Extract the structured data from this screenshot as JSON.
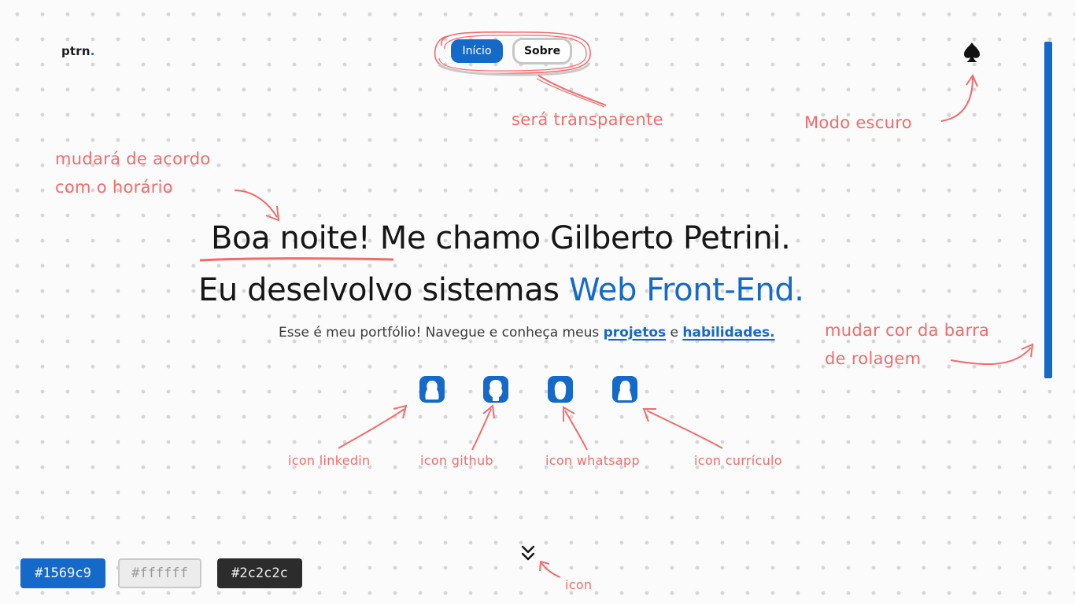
{
  "header": {
    "logo_text": "ptrn",
    "logo_dot": ".",
    "nav": {
      "home_label": "Início",
      "about_label": "Sobre"
    },
    "theme_toggle_icon": "spade-icon"
  },
  "annotations": {
    "nav_note": "será transparente",
    "theme_note": "Modo escuro",
    "greeting_note_line1": "mudará de acordo",
    "greeting_note_line2": "com o horário",
    "scrollbar_note_line1": "mudar cor da barra",
    "scrollbar_note_line2": "de rolagem",
    "linkedin_note": "icon linkedin",
    "github_note": "icon github",
    "whatsapp_note": "icon whatsapp",
    "resume_note": "icon currículo",
    "scroll_icon_note": "icon"
  },
  "hero": {
    "greeting": "Boa noite!",
    "intro": " Me chamo Gilberto Petrini.",
    "line2_prefix": "Eu deselvolvo sistemas ",
    "line2_accent": "Web Front-End.",
    "subtitle_prefix": "Esse é meu portfólio! Navegue e conheça meus ",
    "projects_link": "projetos",
    "subtitle_middle": " e ",
    "skills_link": "habilidades."
  },
  "social_icons": [
    "linkedin-icon",
    "github-icon",
    "whatsapp-icon",
    "resume-icon"
  ],
  "scroll_icon": "double-chevron-down-icon",
  "swatches": {
    "blue": "#1569c9",
    "white": "#ffffff",
    "dark": "#2c2c2c"
  },
  "colors": {
    "accent": "#1569c9",
    "annotation": "#f26b6b",
    "text": "#161616"
  }
}
